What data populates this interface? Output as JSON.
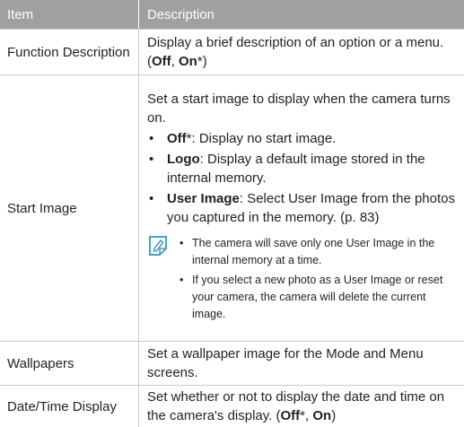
{
  "header": {
    "item": "Item",
    "description": "Description"
  },
  "rows": {
    "function_description": {
      "item": "Function Description",
      "desc_pre": "Display a brief description of an option or a menu. (",
      "off": "Off",
      "sep": ", ",
      "on": "On",
      "desc_post": "*)"
    },
    "start_image": {
      "item": "Start Image",
      "intro": "Set a start image to display when the camera turns on.",
      "options": [
        {
          "bold": "Off",
          "text": "*: Display no start image."
        },
        {
          "bold": "Logo",
          "text": ": Display a default image stored in the internal memory."
        },
        {
          "bold": "User Image",
          "text": ": Select User Image from the photos you captured in the memory. (p. 83)"
        }
      ],
      "note_icon": "note-pencil-icon",
      "notes": [
        "The camera will save only one User Image in the internal memory at a time.",
        "If you select a new photo as a User Image or reset your camera, the camera will delete the current image."
      ]
    },
    "wallpapers": {
      "item": "Wallpapers",
      "desc": "Set a wallpaper image for the Mode and Menu screens."
    },
    "date_time_display": {
      "item": "Date/Time Display",
      "desc_pre": "Set whether or not to display the date and time on the camera's display. (",
      "off": "Off",
      "star_sep": "*, ",
      "on": "On",
      "desc_post": ")"
    }
  },
  "bullet": "•",
  "colors": {
    "header_bg": "#a0a0a0",
    "header_text": "#ffffff",
    "border": "#c9c9c9",
    "note_icon": "#4a9fc4"
  }
}
